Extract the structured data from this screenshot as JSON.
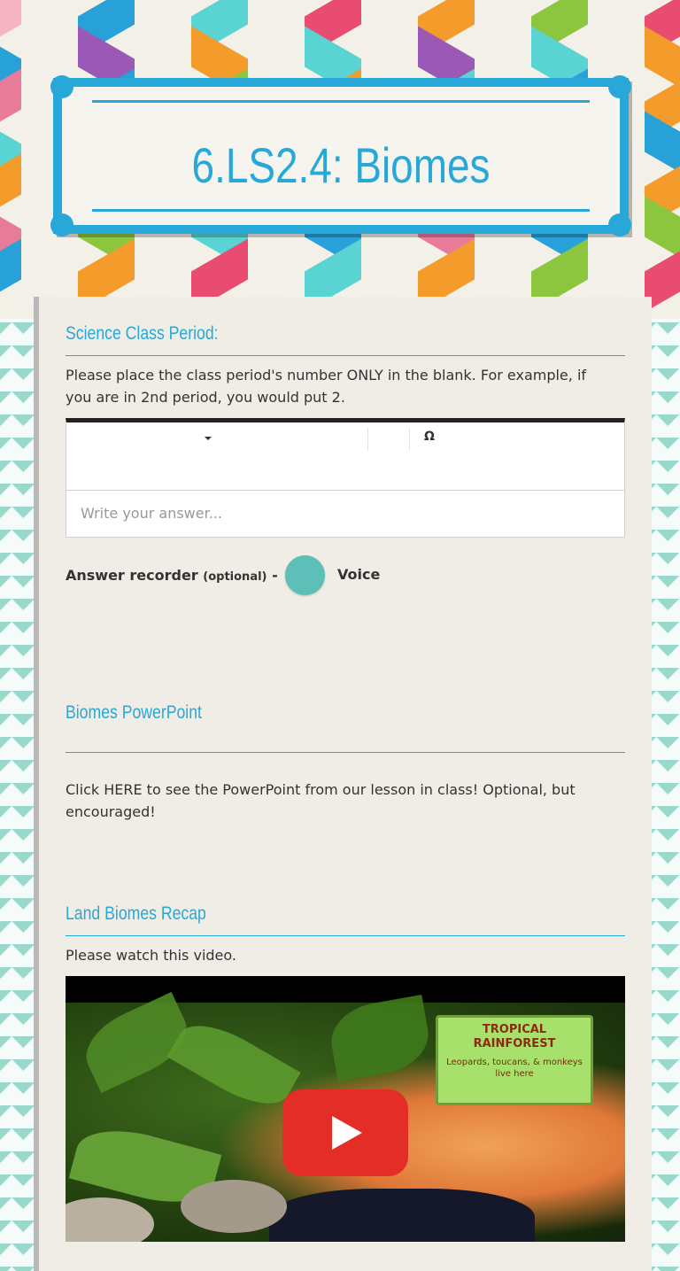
{
  "header": {
    "title": "6.LS2.4: Biomes"
  },
  "sections": {
    "period": {
      "title": "Science Class Period:",
      "instructions": "Please place the class period's number ONLY in the blank. For example, if you are in 2nd period, you would put 2.",
      "special_char_symbol": "Ω",
      "answer_placeholder": "Write your answer...",
      "recorder_label": "Answer recorder",
      "recorder_optional": "(optional)",
      "recorder_dash": "-",
      "voice_label": "Voice"
    },
    "powerpoint": {
      "title": "Biomes PowerPoint",
      "text": "Click HERE to see the PowerPoint from our lesson in class! Optional, but encouraged!"
    },
    "video": {
      "title": "Land Biomes Recap",
      "text": "Please watch this video.",
      "sign_title_1": "TROPICAL",
      "sign_title_2": "RAINFOREST",
      "sign_caption_1": "Leopards, toucans, & monkeys",
      "sign_caption_2": "live here"
    }
  },
  "colors": {
    "accent": "#28a8d8",
    "mic": "#5ebfb9",
    "play": "#e52d27"
  },
  "icons": {
    "dropdown": "caret-down-icon",
    "special_char": "omega-icon",
    "mic": "microphone-button",
    "play": "play-icon"
  }
}
